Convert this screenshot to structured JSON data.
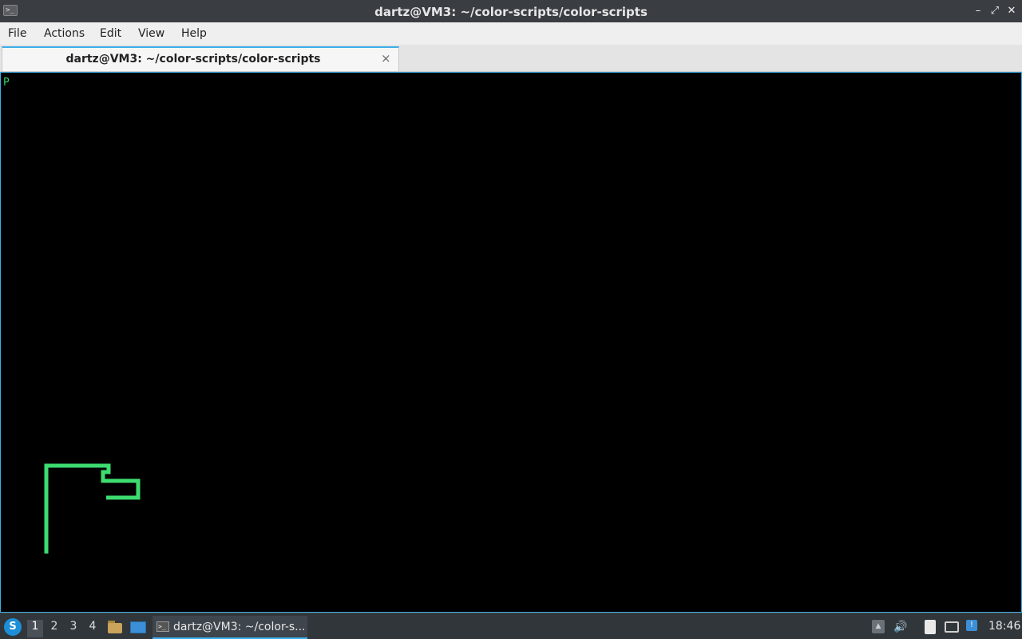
{
  "window": {
    "title": "dartz@VM3: ~/color-scripts/color-scripts",
    "controls": {
      "minimize_icon": "minimize-icon",
      "maximize_icon": "maximize-icon",
      "close_icon": "close-icon"
    }
  },
  "menu": {
    "file": "File",
    "actions": "Actions",
    "edit": "Edit",
    "view": "View",
    "help": "Help"
  },
  "tab": {
    "label": "dartz@VM3: ~/color-scripts/color-scripts",
    "close_glyph": "×"
  },
  "terminal": {
    "output_char": "P",
    "background": "#000000",
    "snake_color": "#3ddc6f"
  },
  "taskbar": {
    "workspaces": [
      "1",
      "2",
      "3",
      "4"
    ],
    "active_workspace": "1",
    "task_label": "dartz@VM3: ~/color-s...",
    "clock": "18:46"
  }
}
